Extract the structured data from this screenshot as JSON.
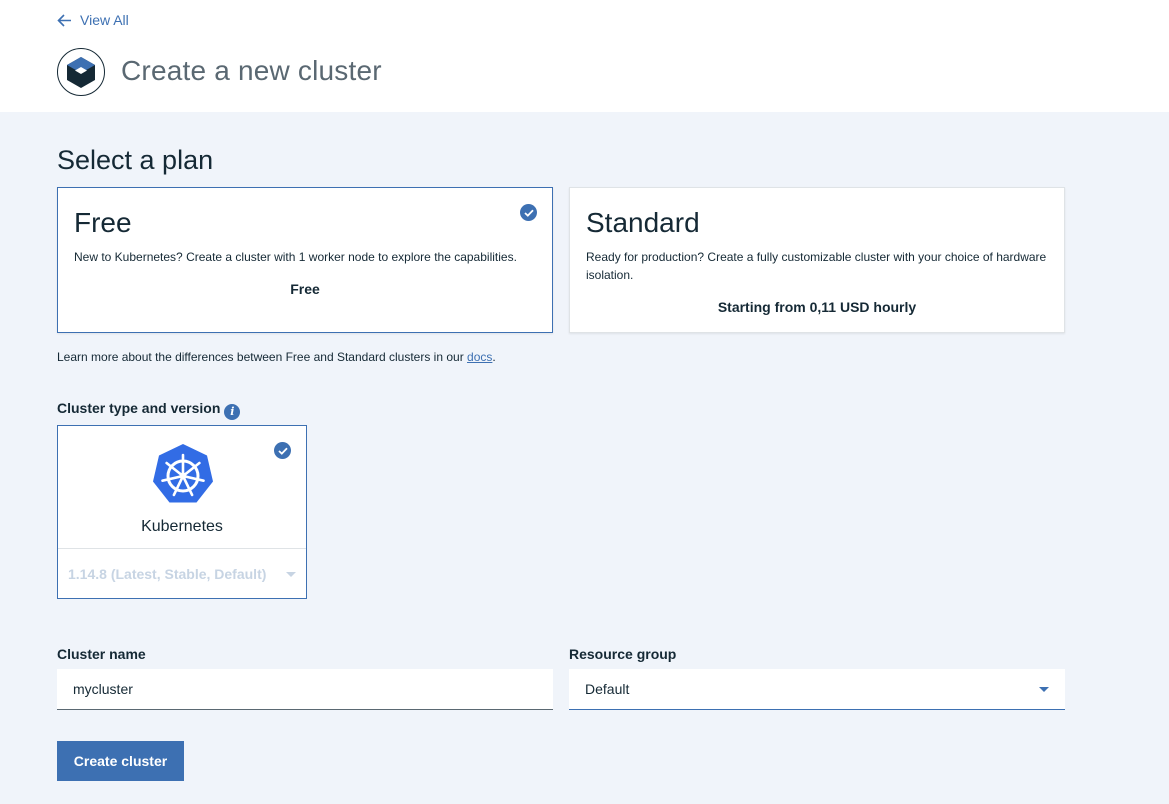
{
  "nav": {
    "back_label": "View All"
  },
  "header": {
    "title": "Create a new cluster"
  },
  "plans": {
    "section_title": "Select a plan",
    "free": {
      "name": "Free",
      "description": "New to Kubernetes? Create a cluster with 1 worker node to explore the capabilities.",
      "price": "Free",
      "selected": true
    },
    "standard": {
      "name": "Standard",
      "description": "Ready for production? Create a fully customizable cluster with your choice of hardware isolation.",
      "price": "Starting from 0,11 USD hourly",
      "selected": false
    },
    "learn_more_prefix": "Learn more about the differences between Free and Standard clusters in our ",
    "learn_more_link": "docs",
    "learn_more_suffix": "."
  },
  "cluster_type": {
    "label": "Cluster type and version",
    "name": "Kubernetes",
    "version": "1.14.8 (Latest, Stable, Default)"
  },
  "form": {
    "cluster_name_label": "Cluster name",
    "cluster_name_value": "mycluster",
    "resource_group_label": "Resource group",
    "resource_group_value": "Default",
    "submit_label": "Create cluster"
  },
  "colors": {
    "accent": "#3d70b2",
    "background": "#f0f4fa",
    "text": "#152935"
  }
}
